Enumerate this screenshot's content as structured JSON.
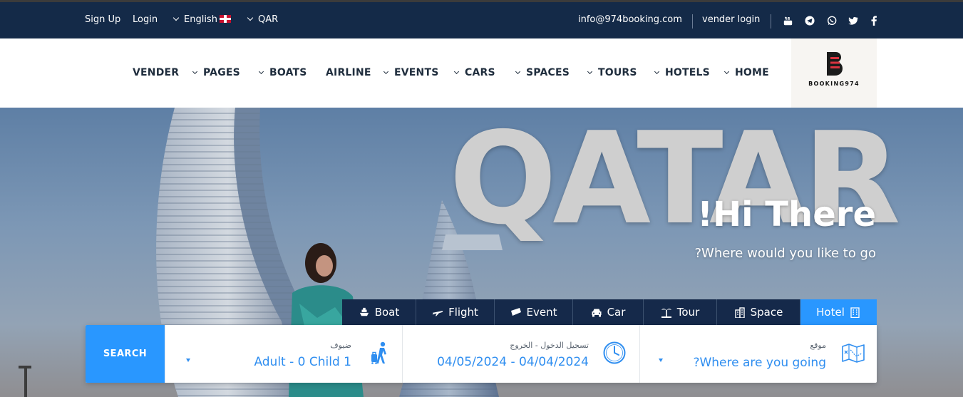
{
  "topbar": {
    "signup": "Sign Up",
    "login": "Login",
    "language": "English",
    "currency": "QAR",
    "email": "info@974booking.com",
    "vender_login": "vender login",
    "socials": [
      "youtube-icon",
      "telegram-icon",
      "whatsapp-icon",
      "twitter-icon",
      "facebook-icon"
    ]
  },
  "nav": {
    "items": [
      {
        "label": "VENDER",
        "dropdown": false
      },
      {
        "label": "PAGES",
        "dropdown": true
      },
      {
        "label": "BOATS",
        "dropdown": true
      },
      {
        "label": "AIRLINE",
        "dropdown": false
      },
      {
        "label": "EVENTS",
        "dropdown": true
      },
      {
        "label": "CARS",
        "dropdown": true
      },
      {
        "label": "SPACES",
        "dropdown": true
      },
      {
        "label": "TOURS",
        "dropdown": true
      },
      {
        "label": "HOTELS",
        "dropdown": true
      },
      {
        "label": "HOME",
        "dropdown": true
      }
    ],
    "logo_text": "BOOKING974"
  },
  "hero": {
    "big_word": "QATAR",
    "greeting": "!Hi There",
    "subtitle": "?Where would you like to go"
  },
  "tabs": [
    {
      "label": "Boat",
      "icon": "ship-icon",
      "active": false
    },
    {
      "label": "Flight",
      "icon": "plane-icon",
      "active": false
    },
    {
      "label": "Event",
      "icon": "ticket-icon",
      "active": false
    },
    {
      "label": "Car",
      "icon": "car-icon",
      "active": false
    },
    {
      "label": "Tour",
      "icon": "island-icon",
      "active": false
    },
    {
      "label": "Space",
      "icon": "building-icon",
      "active": false
    },
    {
      "label": "Hotel",
      "icon": "hotel-icon",
      "active": true
    }
  ],
  "search": {
    "button_label": "SEARCH",
    "guests": {
      "label": "ضيوف",
      "value": "Adult - 0 Child 1",
      "icon": "traveler-icon"
    },
    "dates": {
      "label": "تسجيل الدخول - الخروج",
      "value": "04/05/2024 - 04/04/2024",
      "icon": "clock-icon"
    },
    "location": {
      "label": "موقع",
      "value": "?Where are you going",
      "icon": "map-icon"
    }
  },
  "colors": {
    "topbar_bg": "#142a48",
    "accent": "#2997ff",
    "tab_bg": "#15294a"
  }
}
